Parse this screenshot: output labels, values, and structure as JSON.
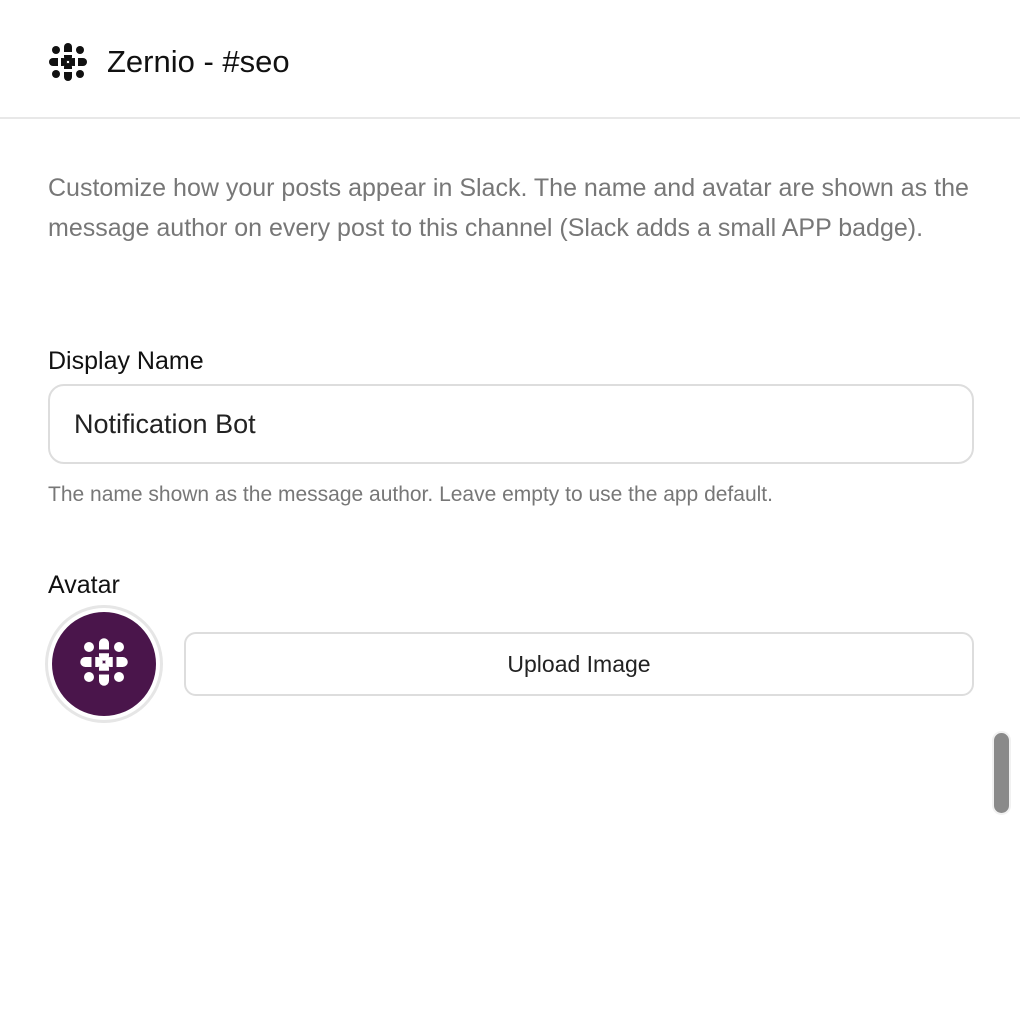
{
  "header": {
    "icon": "slack-logo-icon",
    "title": "Zernio - #seo"
  },
  "description": "Customize how your posts appear in Slack. The name and avatar are shown as the message author on every post to this channel (Slack adds a small APP badge).",
  "display_name": {
    "label": "Display Name",
    "value": "Notification Bot",
    "help": "The name shown as the message author. Leave empty to use the app default."
  },
  "avatar": {
    "label": "Avatar",
    "icon": "slack-logo-icon",
    "background_color": "#4a154b",
    "upload_label": "Upload Image"
  }
}
